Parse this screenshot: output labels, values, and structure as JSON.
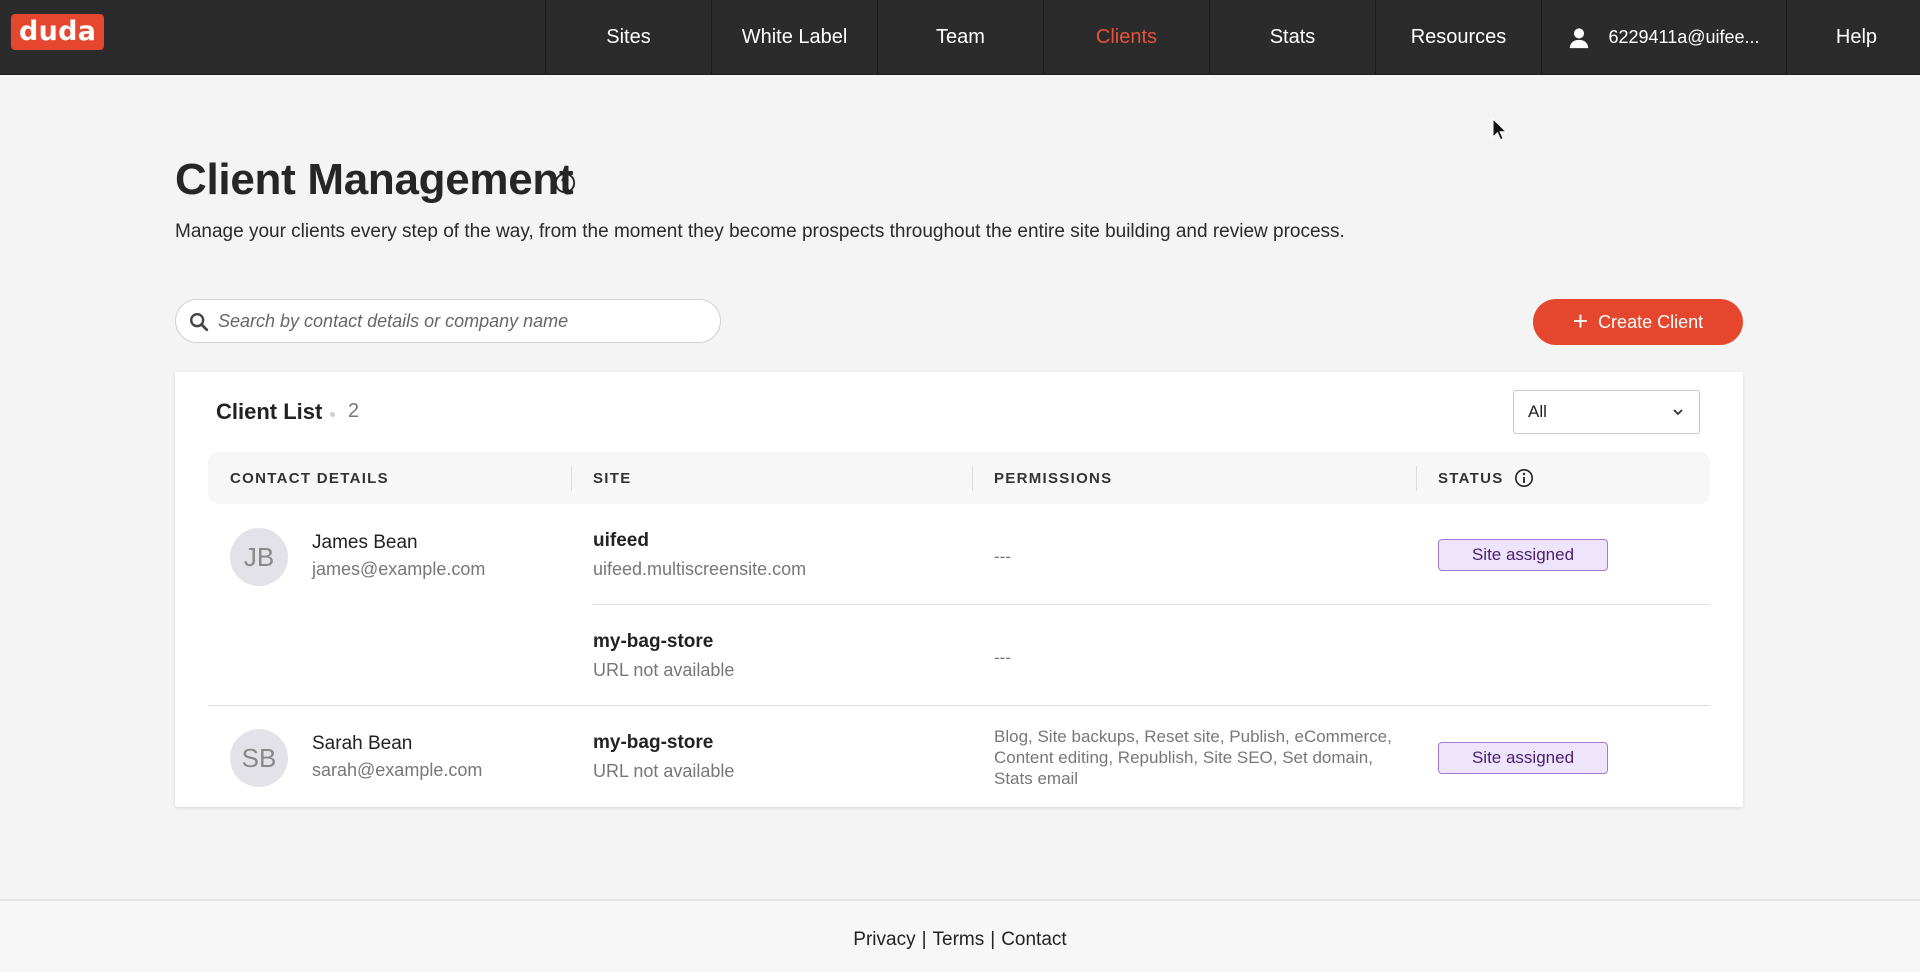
{
  "brand": {
    "logo_text": "duda",
    "accent": "#e5462e"
  },
  "nav": {
    "items": [
      {
        "label": "Sites",
        "active": false
      },
      {
        "label": "White Label",
        "active": false
      },
      {
        "label": "Team",
        "active": false
      },
      {
        "label": "Clients",
        "active": true
      },
      {
        "label": "Stats",
        "active": false
      },
      {
        "label": "Resources",
        "active": false
      }
    ],
    "account_label": "6229411a@uifee...",
    "help_label": "Help"
  },
  "header": {
    "title": "Client Management",
    "subtitle": "Manage your clients every step of the way, from the moment they become prospects throughout the entire site building and review process."
  },
  "search": {
    "placeholder": "Search by contact details or company name",
    "value": ""
  },
  "create_button": {
    "label": "Create Client"
  },
  "client_list": {
    "title": "Client List",
    "count": "2",
    "filter": {
      "selected": "All"
    },
    "columns": [
      "CONTACT DETAILS",
      "SITE",
      "PERMISSIONS",
      "STATUS"
    ],
    "clients": [
      {
        "initials": "JB",
        "name": "James Bean",
        "email": "james@example.com",
        "sites": [
          {
            "name": "uifeed",
            "url": "uifeed.multiscreensite.com",
            "permissions": "---",
            "status": "Site assigned"
          },
          {
            "name": "my-bag-store",
            "url": "URL not available",
            "permissions": "---",
            "status": ""
          }
        ]
      },
      {
        "initials": "SB",
        "name": "Sarah Bean",
        "email": "sarah@example.com",
        "sites": [
          {
            "name": "my-bag-store",
            "url": "URL not available",
            "permissions": "Blog, Site backups, Reset site, Publish, eCommerce, Content editing, Republish, Site SEO, Set domain, Stats email",
            "status": "Site assigned"
          }
        ]
      }
    ]
  },
  "footer": {
    "links": [
      "Privacy",
      "Terms",
      "Contact"
    ],
    "separator": "|"
  },
  "status_colors": {
    "site_assigned_bg": "#eee4fb",
    "site_assigned_border": "#a27bd0",
    "site_assigned_text": "#4b2070"
  }
}
